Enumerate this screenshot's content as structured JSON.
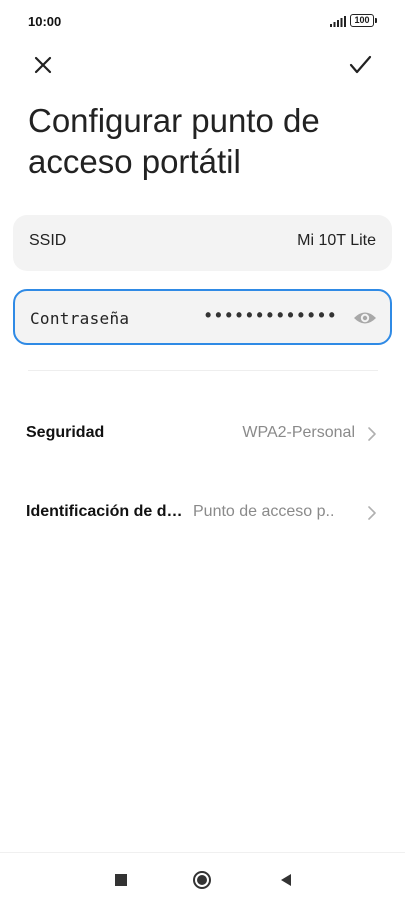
{
  "status_bar": {
    "time": "10:00",
    "battery": "100",
    "signal_icon": "signal-icon"
  },
  "header": {
    "close_icon": "close-icon",
    "confirm_icon": "check-icon",
    "title": "Configurar punto de acceso portátil"
  },
  "form": {
    "ssid": {
      "label": "SSID",
      "value": "Mi 10T Lite"
    },
    "password": {
      "label": "Contraseña",
      "value": "•••••••••••••",
      "toggle_icon": "eye-icon"
    }
  },
  "settings": [
    {
      "label": "Seguridad",
      "value": "WPA2-Personal"
    },
    {
      "label": "Identificación de d…",
      "value": "Punto de acceso p.."
    }
  ],
  "navbar": {
    "recents_icon": "square-icon",
    "home_icon": "circle-icon",
    "back_icon": "back-triangle-icon"
  },
  "colors": {
    "accent": "#2f8ae5",
    "card_bg": "#f3f3f3",
    "secondary_text": "#8a8a8a"
  }
}
